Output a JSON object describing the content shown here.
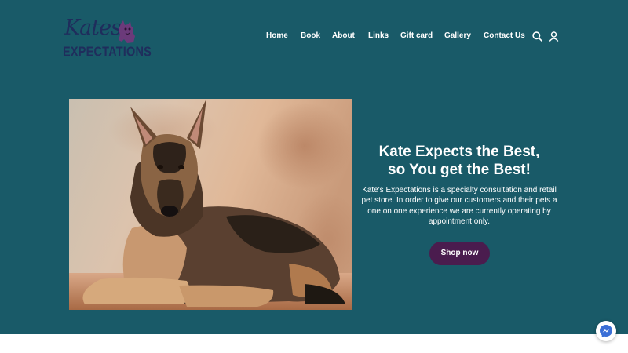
{
  "header": {
    "logo": {
      "line1": "Kates",
      "line2": "EXPECTATIONS"
    },
    "nav": [
      {
        "label": "Home"
      },
      {
        "label": "Book"
      },
      {
        "label": "About"
      },
      {
        "label": "Links"
      },
      {
        "label": "Gift card"
      },
      {
        "label": "Gallery"
      },
      {
        "label": "Contact Us"
      }
    ],
    "icons": {
      "search": "search-icon",
      "account": "user-icon"
    }
  },
  "hero": {
    "image": "german-shepherd-dog-photo",
    "title_line1": "Kate Expects the Best,",
    "title_line2": "so You get the Best!",
    "text": "Kate's Expectations is a specialty consultation and retail pet store. In order to give our customers and their pets a one on one experience we are currently operating by appointment only.",
    "cta_label": "Shop now"
  },
  "widgets": {
    "chat": "messenger-icon"
  },
  "colors": {
    "background": "#195a68",
    "button": "#4a1c4e",
    "logo": "#1f2d5c",
    "logo_accent": "#6b3a7a",
    "text": "#ffffff"
  }
}
